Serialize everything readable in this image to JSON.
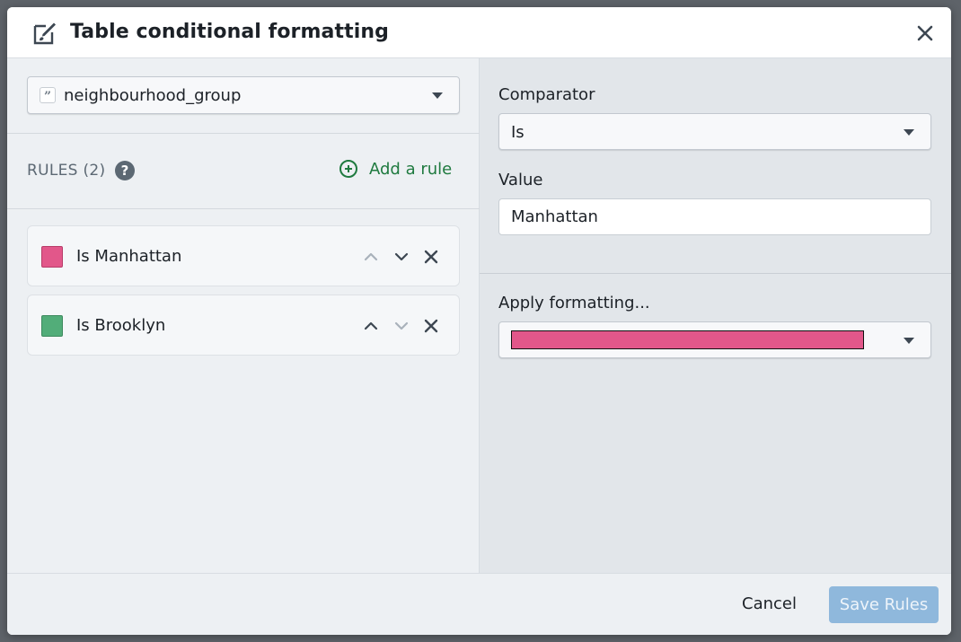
{
  "dialog": {
    "title": "Table conditional formatting",
    "title_icon": "edit-brush-icon",
    "close_icon": "close-icon"
  },
  "column_select": {
    "value": "neighbourhood_group",
    "type_icon": "string-type-icon"
  },
  "rules_panel": {
    "header": "RULES (2)",
    "help_icon": "help-icon",
    "add_rule_label": "Add a rule"
  },
  "rules": [
    {
      "label": "Is Manhattan",
      "color": "#e2578a",
      "move_up_enabled": false,
      "move_down_enabled": true
    },
    {
      "label": "Is Brooklyn",
      "color": "#52ad79",
      "move_up_enabled": true,
      "move_down_enabled": false
    }
  ],
  "editor": {
    "comparator_label": "Comparator",
    "comparator_value": "Is",
    "value_label": "Value",
    "value_input": "Manhattan",
    "apply_label": "Apply formatting...",
    "apply_color": "#e2578a"
  },
  "footer": {
    "cancel_label": "Cancel",
    "save_label": "Save Rules"
  },
  "colors": {
    "accent_green": "#1f7a3f",
    "save_disabled": "#8fb8dc"
  }
}
